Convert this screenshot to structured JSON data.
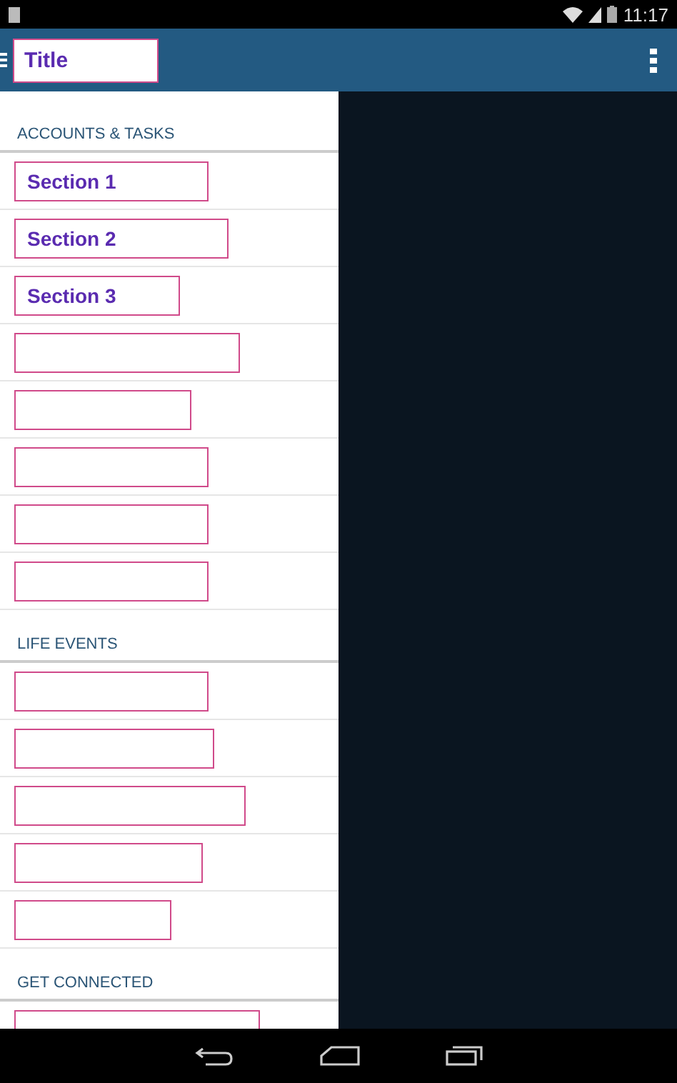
{
  "status_bar": {
    "time": "11:17"
  },
  "app_bar": {
    "title": "Title"
  },
  "drawer": {
    "sections": [
      {
        "heading": "ACCOUNTS & TASKS",
        "items": [
          {
            "kind": "labeled",
            "label": "Section 1"
          },
          {
            "kind": "labeled",
            "label": "Section 2"
          },
          {
            "kind": "labeled",
            "label": "Section 3"
          },
          {
            "kind": "redacted"
          },
          {
            "kind": "redacted"
          },
          {
            "kind": "redacted"
          },
          {
            "kind": "redacted"
          },
          {
            "kind": "redacted"
          }
        ]
      },
      {
        "heading": "LIFE EVENTS",
        "items": [
          {
            "kind": "redacted"
          },
          {
            "kind": "redacted"
          },
          {
            "kind": "redacted"
          },
          {
            "kind": "redacted"
          },
          {
            "kind": "redacted"
          }
        ]
      },
      {
        "heading": "GET CONNECTED",
        "items": [
          {
            "kind": "redacted"
          }
        ]
      }
    ]
  }
}
